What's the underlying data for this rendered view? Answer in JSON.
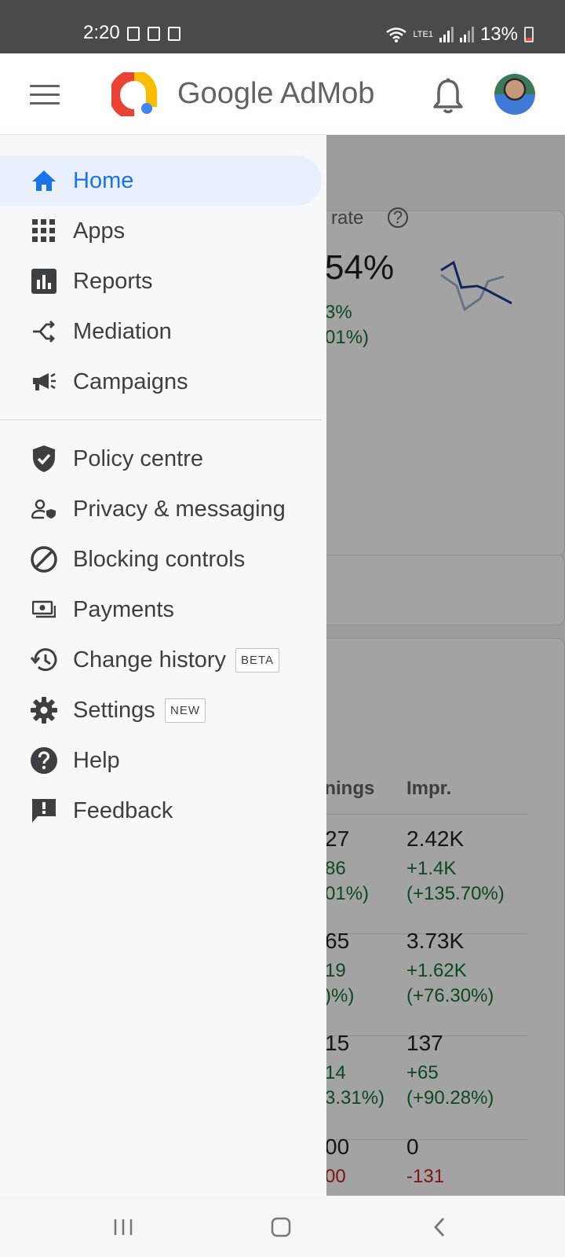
{
  "status_bar": {
    "time": "2:20",
    "battery": "13%",
    "network": "LTE1"
  },
  "header": {
    "brand_google": "Google",
    "brand_product": "AdMob"
  },
  "drawer": {
    "primary": [
      {
        "label": "Home",
        "icon": "home-icon",
        "active": true
      },
      {
        "label": "Apps",
        "icon": "apps-grid-icon"
      },
      {
        "label": "Reports",
        "icon": "reports-chart-icon"
      },
      {
        "label": "Mediation",
        "icon": "mediation-icon"
      },
      {
        "label": "Campaigns",
        "icon": "megaphone-icon"
      }
    ],
    "secondary": [
      {
        "label": "Policy centre",
        "icon": "shield-check-icon"
      },
      {
        "label": "Privacy & messaging",
        "icon": "privacy-person-icon"
      },
      {
        "label": "Blocking controls",
        "icon": "block-icon"
      },
      {
        "label": "Payments",
        "icon": "payments-icon"
      },
      {
        "label": "Change history",
        "icon": "history-icon",
        "badge": "BETA"
      },
      {
        "label": "Settings",
        "icon": "gear-icon",
        "badge": "NEW"
      },
      {
        "label": "Help",
        "icon": "help-icon"
      },
      {
        "label": "Feedback",
        "icon": "feedback-icon"
      }
    ]
  },
  "background": {
    "metric_label": "ch rate",
    "metric_value": "54%",
    "metric_change_1": "3%",
    "metric_change_2": "01%)",
    "table_header_earnings": "rnings",
    "table_header_impr": "Impr.",
    "rows": [
      {
        "earn": "27",
        "earn_delta": "86",
        "earn_pct": "01%)",
        "impr": "2.42K",
        "impr_delta": "+1.4K",
        "impr_pct": "(+135.70%)"
      },
      {
        "earn": "65",
        "earn_delta": "19",
        "earn_pct": ")%)",
        "impr": "3.73K",
        "impr_delta": "+1.62K",
        "impr_pct": "(+76.30%)"
      },
      {
        "earn": "15",
        "earn_delta": "14",
        "earn_pct": "3.31%)",
        "impr": "137",
        "impr_delta": "+65",
        "impr_pct": "(+90.28%)"
      },
      {
        "earn": "00",
        "earn_delta": "00",
        "impr": "0",
        "impr_delta": "-131"
      }
    ]
  },
  "colors": {
    "accent": "#1a73e8",
    "active_bg": "#e8f0fe",
    "positive": "#137333",
    "negative": "#c5221f"
  }
}
